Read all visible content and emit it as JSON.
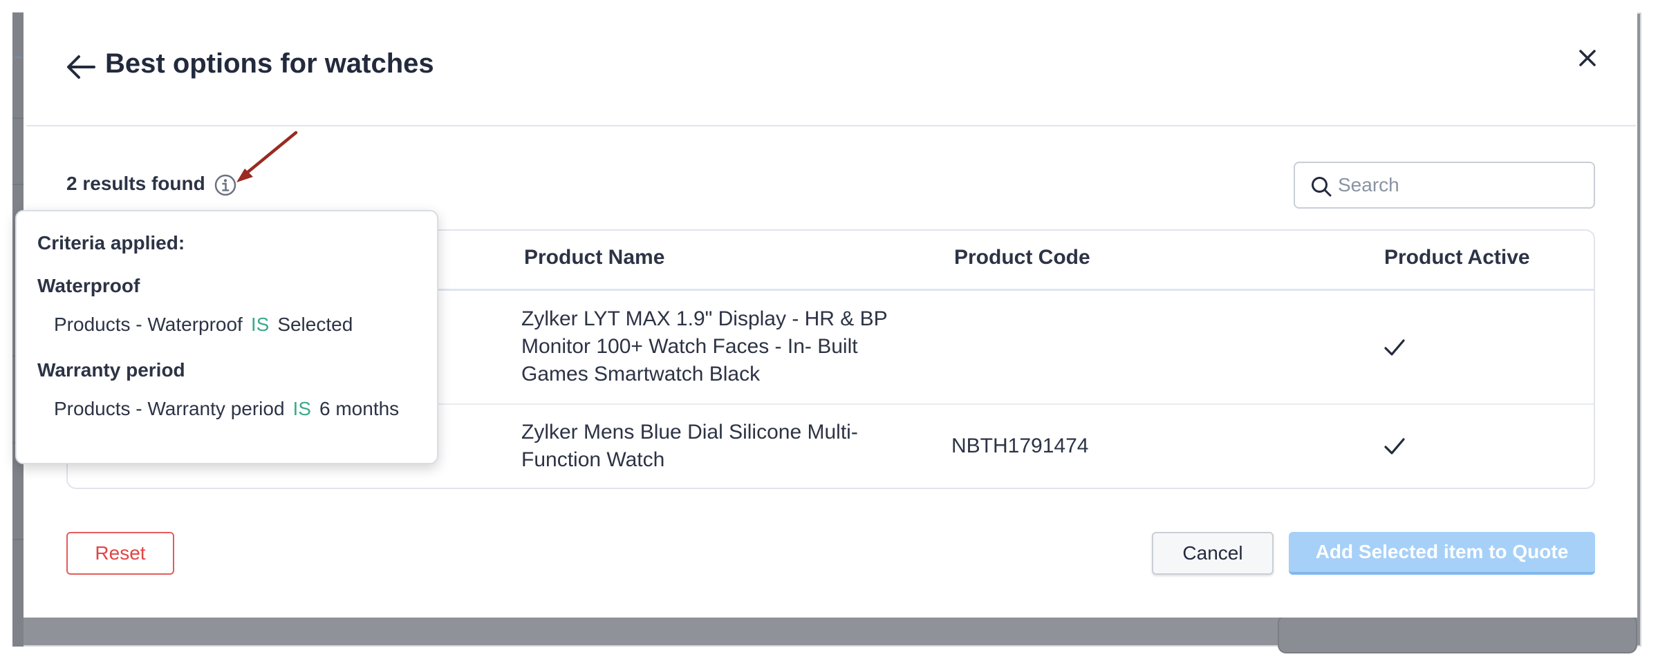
{
  "modal": {
    "title": "Best options for watches",
    "results_count": "2",
    "results_label": "results found"
  },
  "search": {
    "placeholder": "Search",
    "value": ""
  },
  "table": {
    "headers": [
      "Product Name",
      "Product Code",
      "Product Active"
    ],
    "rows": [
      {
        "name_lines": [
          "Zylker LYT MAX 1.9\" Display - HR & BP",
          "Monitor 100+ Watch Faces - In- Built",
          "Games Smartwatch Black"
        ],
        "code": "",
        "active": true
      },
      {
        "name_lines": [
          "Zylker Mens Blue Dial Silicone Multi-",
          "Function Watch"
        ],
        "code": "NBTH1791474",
        "active": true
      }
    ]
  },
  "criteria_popover": {
    "title": "Criteria applied:",
    "groups": [
      {
        "heading": "Waterproof",
        "field": "Products - Waterproof",
        "operator": "IS",
        "value": "Selected"
      },
      {
        "heading": "Warranty period",
        "field": "Products - Warranty period",
        "operator": "IS",
        "value": "6 months"
      }
    ]
  },
  "footer": {
    "reset_label": "Reset",
    "cancel_label": "Cancel",
    "add_label": "Add Selected item to Quote"
  },
  "colors": {
    "accent_operator": "#3aaa8c",
    "reset_red": "#e04545",
    "primary_disabled": "#a6d0f7",
    "annotation_arrow": "#9a2a22"
  },
  "icons": [
    "back-arrow-icon",
    "close-icon",
    "info-icon",
    "search-icon",
    "checkmark-icon",
    "annotation-arrow-icon"
  ]
}
